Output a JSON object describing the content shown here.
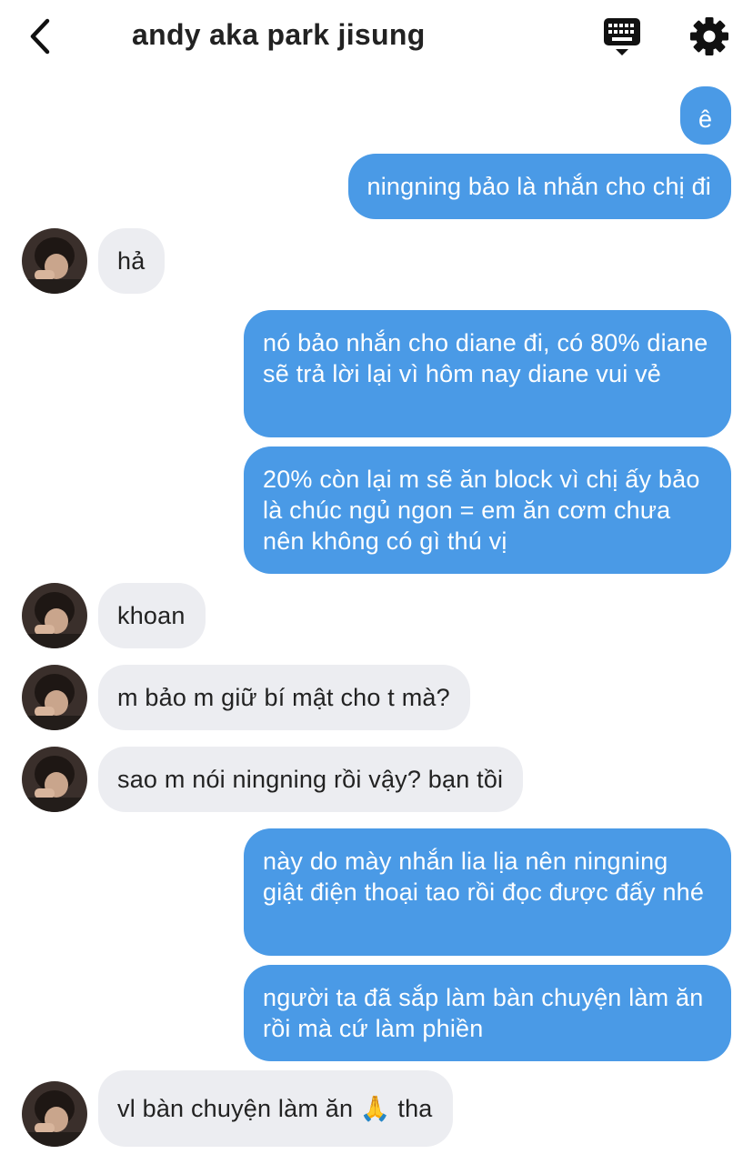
{
  "header": {
    "back_icon": "chevron-left-icon",
    "title": "andy aka park jisung",
    "keyboard_icon": "keyboard-icon",
    "settings_icon": "gear-icon"
  },
  "colors": {
    "outgoing_bubble": "#4a9ae6",
    "incoming_bubble": "#ecedf1",
    "text_dark": "#222222"
  },
  "messages": [
    {
      "direction": "outgoing",
      "text": "ê"
    },
    {
      "direction": "outgoing",
      "text": "ningning bảo là nhắn cho chị đi"
    },
    {
      "direction": "incoming",
      "text": "hả"
    },
    {
      "direction": "outgoing",
      "text": "nó bảo nhắn cho diane đi, có 80% diane sẽ trả lời lại vì hôm nay diane vui vẻ"
    },
    {
      "direction": "outgoing",
      "text": "20% còn lại m sẽ ăn block vì chị ấy bảo là chúc ngủ ngon = em ăn cơm chưa nên không có gì thú vị"
    },
    {
      "direction": "incoming",
      "text": "khoan"
    },
    {
      "direction": "incoming",
      "text": "m bảo m giữ bí mật cho t mà?"
    },
    {
      "direction": "incoming",
      "text": "sao m nói ningning rồi vậy? bạn tồi"
    },
    {
      "direction": "outgoing",
      "text": "này do mày nhắn lia lịa nên ningning giật điện thoại tao rồi đọc được đấy nhé"
    },
    {
      "direction": "outgoing",
      "text": "người ta đã sắp làm bàn chuyện làm ăn rồi mà cứ làm phiền"
    },
    {
      "direction": "incoming",
      "text": "vl bàn chuyện làm ăn 🙏 tha"
    }
  ],
  "avatar_icon": "avatar"
}
